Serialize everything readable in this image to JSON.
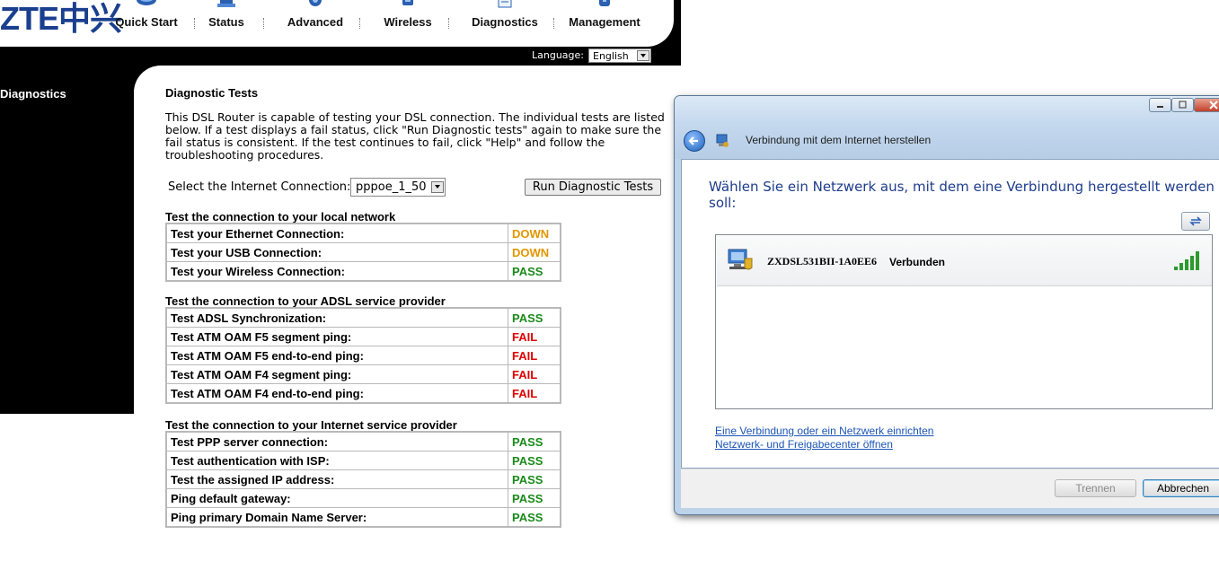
{
  "router": {
    "logo": "ZTE中兴",
    "nav": [
      {
        "label": "Quick Start",
        "icon": "quick-start-icon"
      },
      {
        "label": "Status",
        "icon": "status-icon"
      },
      {
        "label": "Advanced",
        "icon": "advanced-icon"
      },
      {
        "label": "Wireless",
        "icon": "wireless-icon"
      },
      {
        "label": "Diagnostics",
        "icon": "diagnostics-icon"
      },
      {
        "label": "Management",
        "icon": "management-icon"
      }
    ],
    "language_label": "Language:",
    "language_value": "English",
    "sidebar": {
      "active_item": "Diagnostics"
    },
    "page_title": "Diagnostic Tests",
    "description": "This DSL Router is capable of testing your DSL connection. The individual tests are listed below. If a test displays a fail status, click \"Run Diagnostic tests\" again to make sure the fail status is consistent. If the test continues to fail, click \"Help\" and follow the troubleshooting procedures.",
    "connection_label": "Select the Internet Connection:",
    "connection_value": "pppoe_1_50",
    "run_button": "Run Diagnostic Tests",
    "sections": [
      {
        "title": "Test the connection to your local network",
        "rows": [
          {
            "name": "Test your Ethernet Connection:",
            "result": "DOWN"
          },
          {
            "name": "Test your USB Connection:",
            "result": "DOWN"
          },
          {
            "name": "Test your Wireless Connection:",
            "result": "PASS"
          }
        ]
      },
      {
        "title": "Test the connection to your ADSL service provider",
        "rows": [
          {
            "name": "Test ADSL Synchronization:",
            "result": "PASS"
          },
          {
            "name": "Test ATM OAM F5 segment ping:",
            "result": "FAIL"
          },
          {
            "name": "Test ATM OAM F5 end-to-end ping:",
            "result": "FAIL"
          },
          {
            "name": "Test ATM OAM F4 segment ping:",
            "result": "FAIL"
          },
          {
            "name": "Test ATM OAM F4 end-to-end ping:",
            "result": "FAIL"
          }
        ]
      },
      {
        "title": "Test the connection to your Internet service provider",
        "rows": [
          {
            "name": "Test PPP server connection:",
            "result": "PASS"
          },
          {
            "name": "Test authentication with ISP:",
            "result": "PASS"
          },
          {
            "name": "Test the assigned IP address:",
            "result": "PASS"
          },
          {
            "name": "Ping default gateway:",
            "result": "PASS"
          },
          {
            "name": "Ping primary Domain Name Server:",
            "result": "PASS"
          }
        ]
      }
    ],
    "colors": {
      "down": "#e29600",
      "pass": "#1b8a1b",
      "fail": "#e00000"
    }
  },
  "dialog": {
    "title": "Verbindung mit dem Internet herstellen",
    "heading": "Wählen Sie ein Netzwerk aus, mit dem eine Verbindung hergestellt werden soll:",
    "network": {
      "name": "ZXDSL531BII-1A0EE6",
      "status": "Verbunden",
      "icon": "wireless-network-icon",
      "signal_bars": 5
    },
    "links": [
      "Eine Verbindung oder ein Netzwerk einrichten",
      "Netzwerk- und Freigabecenter öffnen"
    ],
    "buttons": {
      "disconnect": "Trennen",
      "cancel": "Abbrechen"
    }
  }
}
